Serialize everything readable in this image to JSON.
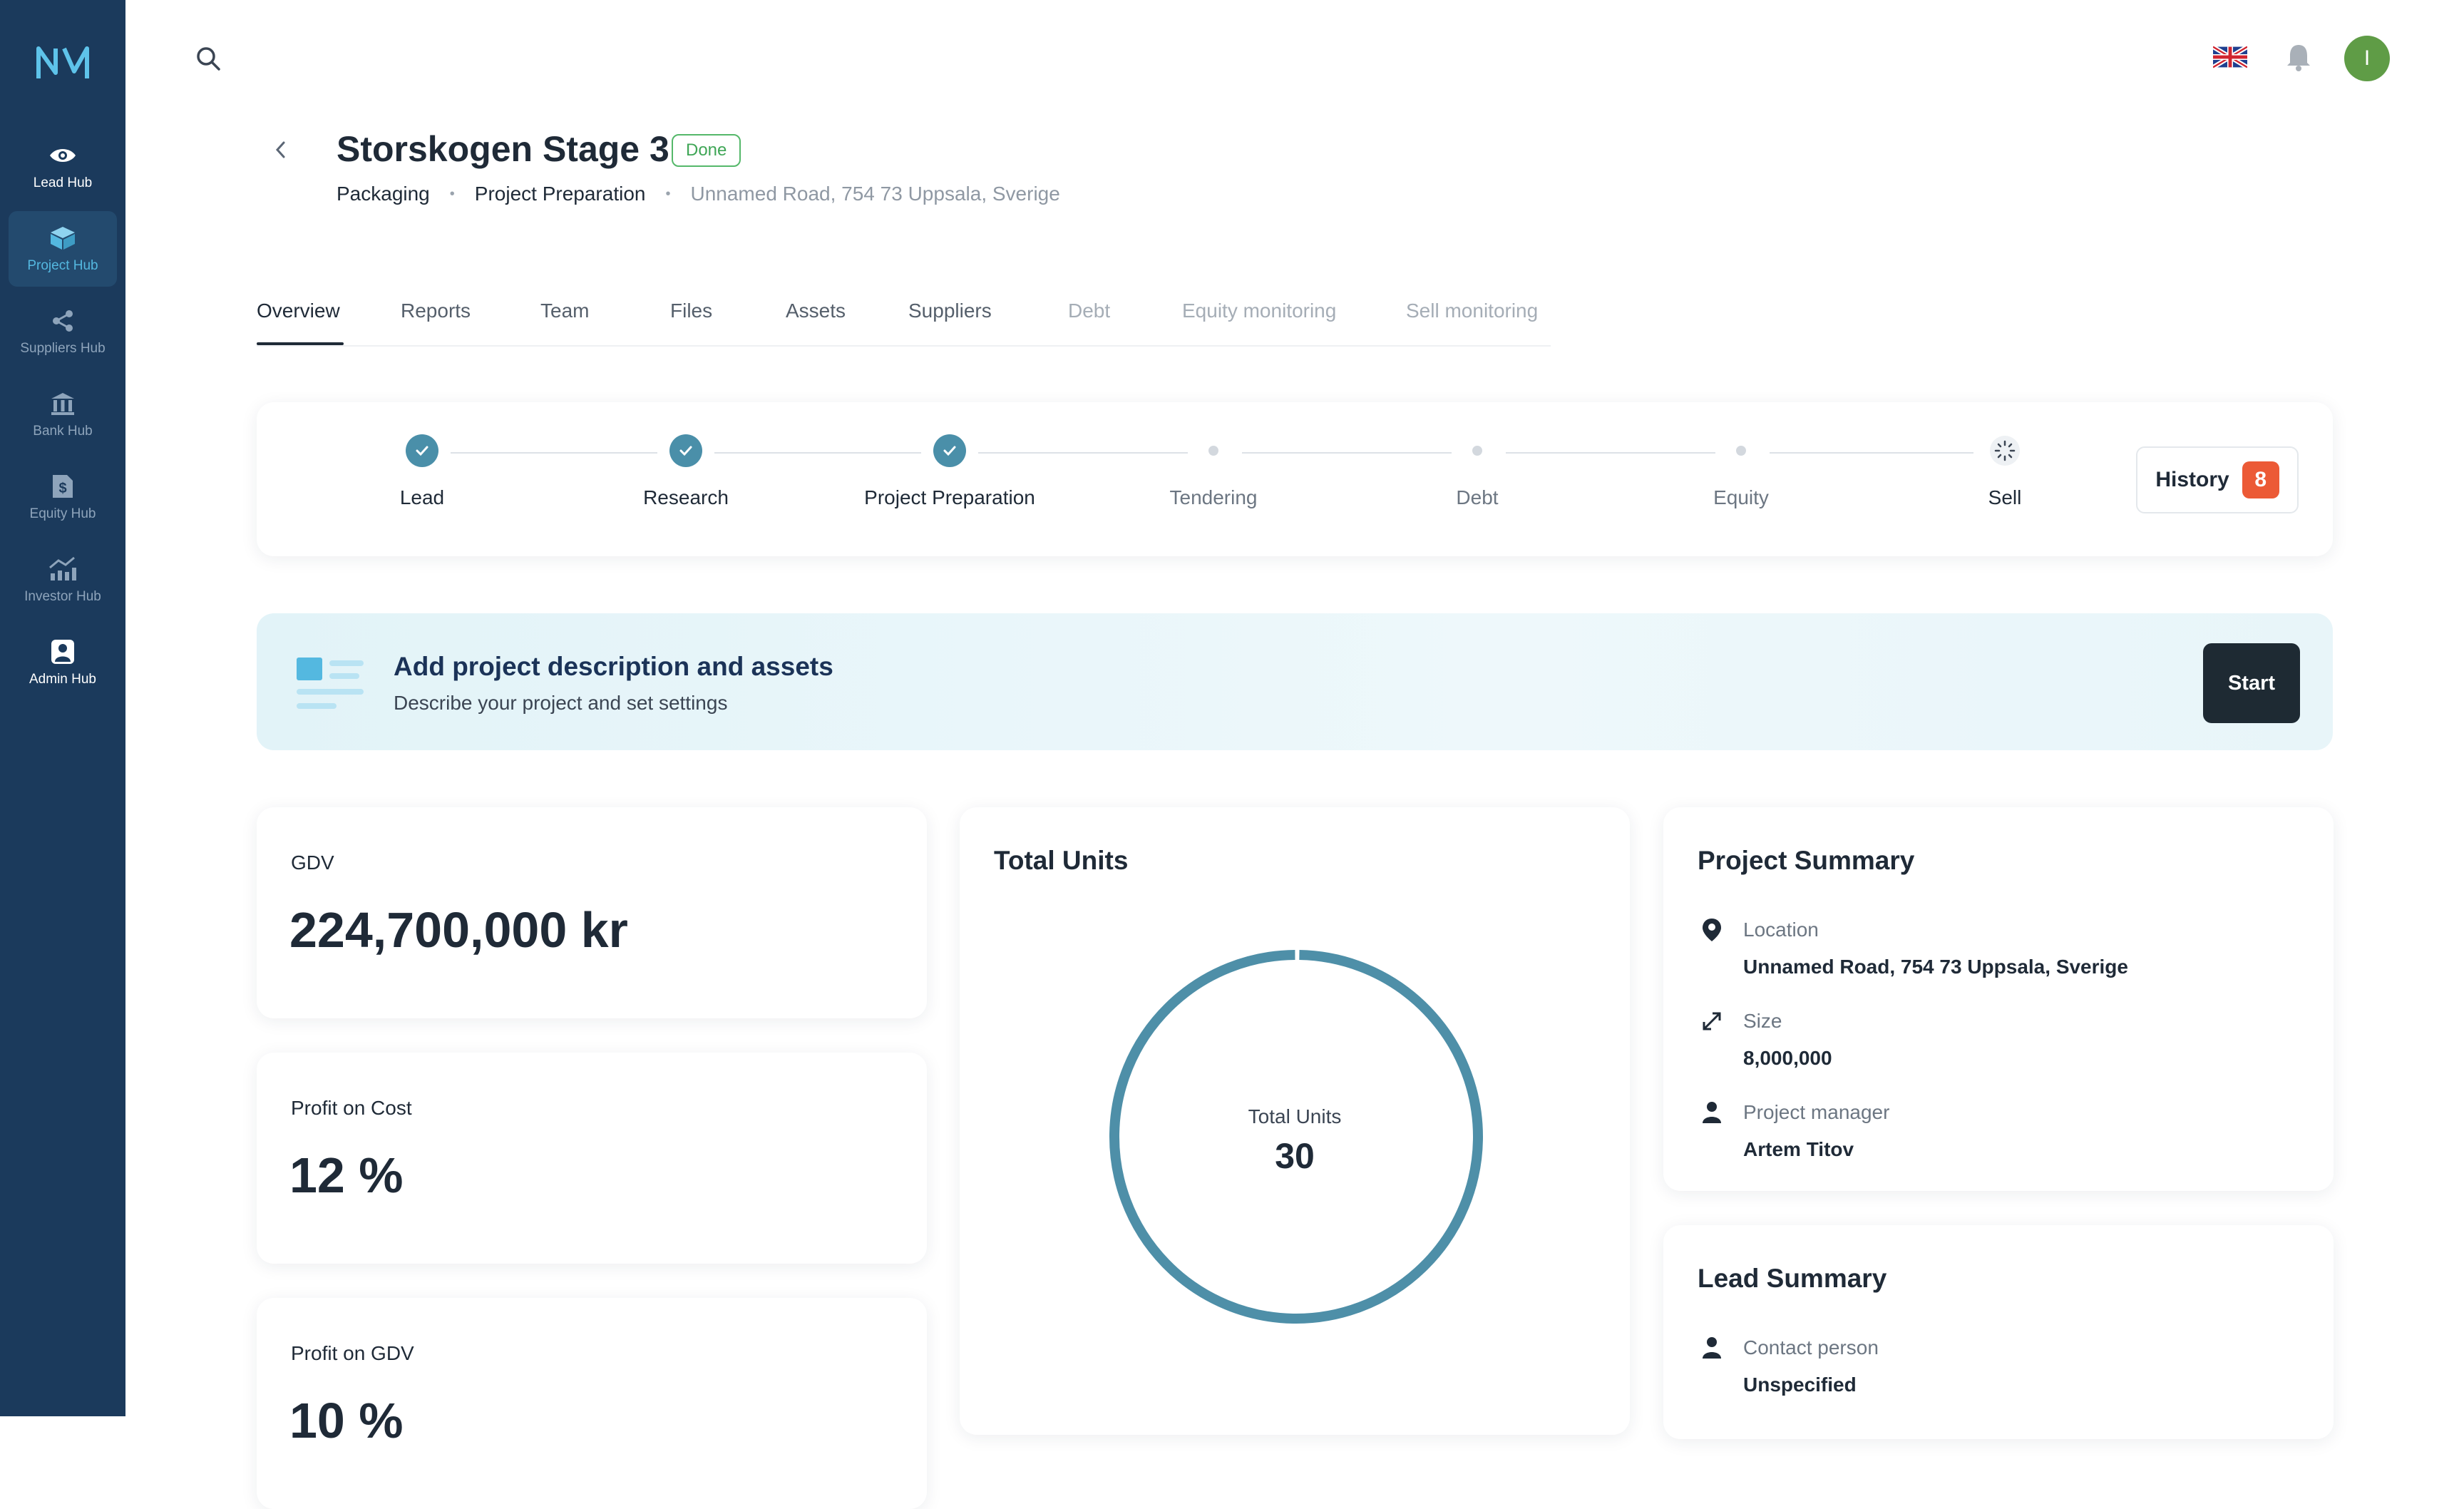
{
  "sidebar": {
    "items": [
      {
        "label": "Lead Hub",
        "icon": "eye-icon"
      },
      {
        "label": "Project Hub",
        "icon": "box-icon"
      },
      {
        "label": "Suppliers Hub",
        "icon": "share-icon"
      },
      {
        "label": "Bank Hub",
        "icon": "bank-icon"
      },
      {
        "label": "Equity Hub",
        "icon": "dollar-document-icon"
      },
      {
        "label": "Investor Hub",
        "icon": "chart-trend-icon"
      },
      {
        "label": "Admin Hub",
        "icon": "user-badge-icon"
      }
    ],
    "active_index": 1
  },
  "header": {
    "avatar_initial": "I",
    "language": "English (UK flag)"
  },
  "project": {
    "title": "Storskogen Stage 3",
    "status": "Done",
    "breadcrumb": [
      "Packaging",
      "Project Preparation",
      "Unnamed Road, 754 73 Uppsala, Sverige"
    ]
  },
  "tabs": [
    {
      "label": "Overview",
      "state": "active"
    },
    {
      "label": "Reports",
      "state": "normal"
    },
    {
      "label": "Team",
      "state": "normal"
    },
    {
      "label": "Files",
      "state": "normal"
    },
    {
      "label": "Assets",
      "state": "normal"
    },
    {
      "label": "Suppliers",
      "state": "normal"
    },
    {
      "label": "Debt",
      "state": "disabled"
    },
    {
      "label": "Equity monitoring",
      "state": "disabled"
    },
    {
      "label": "Sell monitoring",
      "state": "disabled"
    }
  ],
  "stepper": {
    "steps": [
      {
        "label": "Lead",
        "state": "done"
      },
      {
        "label": "Research",
        "state": "done"
      },
      {
        "label": "Project Preparation",
        "state": "done"
      },
      {
        "label": "Tendering",
        "state": "pending"
      },
      {
        "label": "Debt",
        "state": "pending"
      },
      {
        "label": "Equity",
        "state": "pending"
      },
      {
        "label": "Sell",
        "state": "loading"
      }
    ],
    "history_label": "History",
    "history_count": "8"
  },
  "banner": {
    "title": "Add project description and assets",
    "subtitle": "Describe your project and set settings",
    "button": "Start"
  },
  "metrics": [
    {
      "label": "GDV",
      "value": "224,700,000 kr"
    },
    {
      "label": "Profit on Cost",
      "value": "12 %"
    },
    {
      "label": "Profit on GDV",
      "value": "10 %"
    }
  ],
  "total_units": {
    "title": "Total Units",
    "center_label": "Total Units",
    "value": "30"
  },
  "project_summary": {
    "title": "Project Summary",
    "rows": [
      {
        "key": "Location",
        "value": "Unnamed Road, 754 73 Uppsala, Sverige",
        "icon": "location-pin-icon"
      },
      {
        "key": "Size",
        "value": "8,000,000",
        "icon": "expand-arrows-icon"
      },
      {
        "key": "Project manager",
        "value": "Artem Titov",
        "icon": "person-icon"
      }
    ]
  },
  "lead_summary": {
    "title": "Lead Summary",
    "rows": [
      {
        "key": "Contact person",
        "value": "Unspecified",
        "icon": "person-icon"
      }
    ]
  },
  "colors": {
    "sidebar_bg": "#1b3a5c",
    "accent": "#4a8fa9",
    "active_nav_text": "#54b8e0",
    "done_badge": "#3fa656",
    "history_badge": "#ec5a36",
    "start_button": "#1e2a33"
  }
}
